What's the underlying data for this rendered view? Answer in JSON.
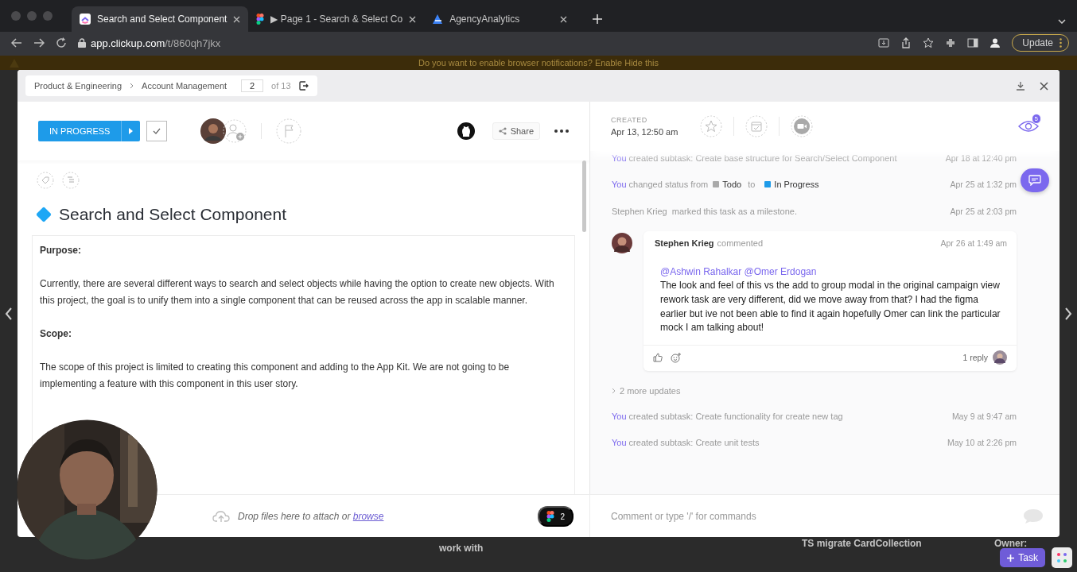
{
  "browser": {
    "tabs": [
      {
        "title": "Search and Select Component",
        "selected": true
      },
      {
        "title": "▶ Page 1 - Search & Select Co",
        "selected": false
      },
      {
        "title": "AgencyAnalytics",
        "selected": false
      }
    ],
    "url": {
      "host": "app.clickup.com",
      "path": "/t/860qh7jkx"
    },
    "update_button": "Update"
  },
  "notification": "Do you want to enable browser notifications?  Enable  Hide this",
  "breadcrumb": {
    "items": [
      "Product & Engineering",
      "Account Management"
    ],
    "page": "2",
    "total": "of 13"
  },
  "task": {
    "status": "IN PROGRESS",
    "title": "Search and Select Component",
    "description": [
      {
        "kind": "heading",
        "text": "Purpose:"
      },
      {
        "kind": "paragraph",
        "text": "Currently, there are several different ways to search and select objects while having the option to create new objects. With this project, the goal is to unify them into a single component that can be reused across the app in scalable manner."
      },
      {
        "kind": "heading",
        "text": "Scope:"
      },
      {
        "kind": "paragraph",
        "text": "The scope of this project is limited to creating this component and adding to the App Kit. We are not going to be implementing a feature with this component in this user story."
      }
    ],
    "share_button": "Share"
  },
  "details": {
    "created_label": "CREATED",
    "created_value": "Apr 13, 12:50 am",
    "watchers": "5"
  },
  "activity": [
    {
      "kind": "event",
      "actor": "You",
      "text": "created subtask: Create base structure for Search/Select Component",
      "time": "Apr 18 at 12:40 pm"
    },
    {
      "kind": "status_change",
      "actor": "You",
      "text": "changed status from",
      "from": {
        "label": "Todo",
        "color": "#aaaaaa"
      },
      "connector": "to",
      "to": {
        "label": "In Progress",
        "color": "#1e9be9"
      },
      "time": "Apr 25 at 1:32 pm"
    },
    {
      "kind": "note",
      "text": "Stephen Krieg  marked this task as a milestone.",
      "time": "Apr 25 at 2:03 pm"
    },
    {
      "kind": "comment",
      "author": "Stephen Krieg",
      "verb": "commented",
      "time": "Apr 26 at 1:49 am",
      "mentions": "@Ashwin Rahalkar @Omer Erdogan",
      "body": "The look and feel of this vs the add to group modal in the original campaign view rework task are very different, did we move away from that? I had the figma earlier but ive not been able to find it again hopefully Omer can link the particular mock I am talking about!",
      "replies": "1 reply"
    },
    {
      "kind": "collapsed",
      "text": "2 more updates"
    },
    {
      "kind": "event",
      "actor": "You",
      "text": "created subtask: Create functionality for create new tag",
      "time": "May 9 at 9:47 am"
    },
    {
      "kind": "event",
      "actor": "You",
      "text": "created subtask: Create unit tests",
      "time": "May 10 at 2:26 pm"
    }
  ],
  "footer": {
    "drop_text": "Drop files here to attach or",
    "browse_link": "browse",
    "figma_count": "2",
    "comment_placeholder": "Comment or type '/' for commands"
  },
  "background": {
    "texts": [
      "work with",
      "TS migrate CardCollection",
      "Owner:"
    ],
    "task_button": "Task"
  }
}
